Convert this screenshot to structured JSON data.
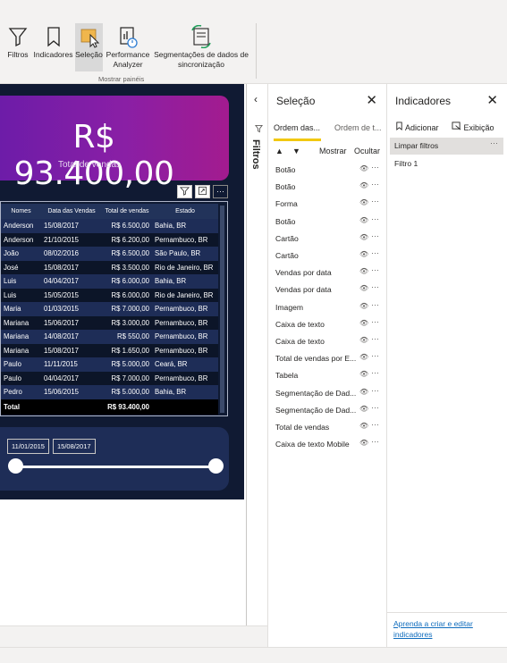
{
  "ribbon": {
    "buttons": [
      {
        "label": "Filtros",
        "icon": "funnel-icon"
      },
      {
        "label": "Indicadores",
        "icon": "bookmark-icon"
      },
      {
        "label": "Seleção",
        "icon": "selection-icon"
      },
      {
        "label": "Performance Analyzer",
        "line1": "Performance",
        "line2": "Analyzer",
        "icon": "performance-analyzer-icon"
      },
      {
        "label": "Segmentações de dados de sincronização",
        "line1": "Segmentações de dados de",
        "line2": "sincronização",
        "icon": "sync-slicers-icon"
      }
    ],
    "group_label": "Mostrar painéis"
  },
  "report": {
    "kpi_value": "R$ 93.400,00",
    "kpi_label": "Total de vendas",
    "table": {
      "headers": [
        "Nomes",
        "Data das Vendas",
        "Total de vendas",
        "Estado"
      ],
      "rows": [
        [
          "Anderson",
          "15/08/2017",
          "R$ 6.500,00",
          "Bahia, BR"
        ],
        [
          "Anderson",
          "21/10/2015",
          "R$ 6.200,00",
          "Pernambuco, BR"
        ],
        [
          "João",
          "08/02/2016",
          "R$ 6.500,00",
          "São Paulo, BR"
        ],
        [
          "José",
          "15/08/2017",
          "R$ 3.500,00",
          "Rio de Janeiro, BR"
        ],
        [
          "Luis",
          "04/04/2017",
          "R$ 6.000,00",
          "Bahia, BR"
        ],
        [
          "Luis",
          "15/05/2015",
          "R$ 6.000,00",
          "Rio de Janeiro, BR"
        ],
        [
          "Maria",
          "01/03/2015",
          "R$ 7.000,00",
          "Pernambuco, BR"
        ],
        [
          "Mariana",
          "15/06/2017",
          "R$ 3.000,00",
          "Pernambuco, BR"
        ],
        [
          "Mariana",
          "14/08/2017",
          "R$ 550,00",
          "Pernambuco, BR"
        ],
        [
          "Mariana",
          "15/08/2017",
          "R$ 1.650,00",
          "Pernambuco, BR"
        ],
        [
          "Paulo",
          "11/11/2015",
          "R$ 5.000,00",
          "Ceará, BR"
        ],
        [
          "Paulo",
          "04/04/2017",
          "R$ 7.000,00",
          "Pernambuco, BR"
        ],
        [
          "Pedro",
          "15/06/2015",
          "R$ 5.000,00",
          "Bahia, BR"
        ]
      ],
      "total_label": "Total",
      "total_value": "R$ 93.400,00"
    },
    "slicer": {
      "start_date": "11/01/2015",
      "end_date": "15/08/2017"
    }
  },
  "filters_pane": {
    "label": "Filtros"
  },
  "selection_pane": {
    "title": "Seleção",
    "tabs": [
      "Ordem das...",
      "Ordem de t..."
    ],
    "show_label": "Mostrar",
    "hide_label": "Ocultar",
    "items": [
      "Botão",
      "Botão",
      "Forma",
      "Botão",
      "Cartão",
      "Cartão",
      "Vendas por data",
      "Vendas por data",
      "Imagem",
      "Caixa de texto",
      "Caixa de texto",
      "Total de vendas por E...",
      "Tabela",
      "Segmentação de Dad...",
      "Segmentação de Dad...",
      "Total de vendas",
      "Caixa de texto Mobile"
    ]
  },
  "bookmarks_pane": {
    "title": "Indicadores",
    "add_label": "Adicionar",
    "view_label": "Exibição",
    "items": [
      "Limpar filtros",
      "Filtro 1"
    ],
    "help_link": "Aprenda a criar e editar indicadores"
  },
  "colors": {
    "report_bg": "#101a33",
    "kpi_gradient_start": "#6d1ca8",
    "kpi_gradient_end": "#a31b8f",
    "accent_tab": "#f2c811",
    "link": "#0f6cbd"
  }
}
